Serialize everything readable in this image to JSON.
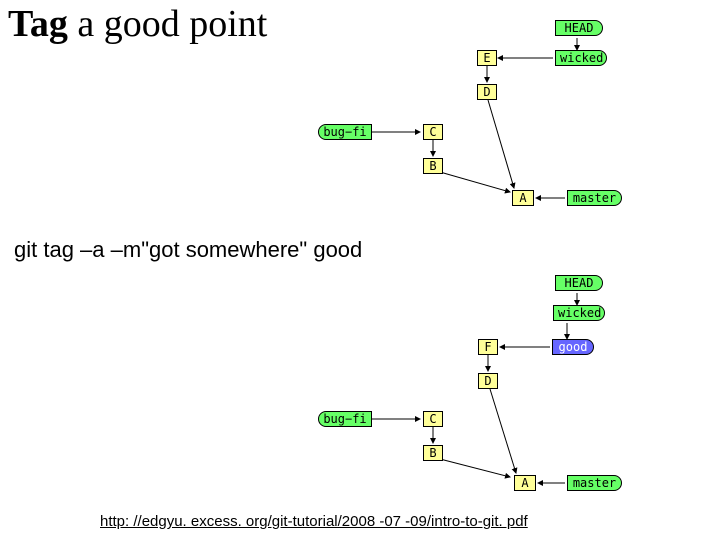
{
  "title_prefix": "Tag",
  "title_rest": " a good point",
  "command": "git tag –a –m\"got somewhere\" good",
  "footer": "http: //edgyu. excess. org/git-tutorial/2008 -07 -09/intro-to-git. pdf",
  "upper": {
    "commits": {
      "E": "E",
      "D": "D",
      "C": "C",
      "B": "B",
      "A": "A"
    },
    "refs": {
      "head": "HEAD",
      "wicked": "wicked",
      "bugfi": "bug−fi",
      "master": "master"
    }
  },
  "lower": {
    "commits": {
      "F": "F",
      "D": "D",
      "C": "C",
      "B": "B",
      "A": "A"
    },
    "refs": {
      "head": "HEAD",
      "wicked": "wicked",
      "bugfi": "bug−fi",
      "master": "master",
      "good": "good"
    }
  },
  "chart_data": [
    {
      "type": "dag",
      "title": "Repository state before tagging",
      "nodes": [
        {
          "id": "E",
          "kind": "commit"
        },
        {
          "id": "D",
          "kind": "commit"
        },
        {
          "id": "C",
          "kind": "commit"
        },
        {
          "id": "B",
          "kind": "commit"
        },
        {
          "id": "A",
          "kind": "commit"
        },
        {
          "id": "HEAD",
          "kind": "head",
          "points_to": "wicked"
        },
        {
          "id": "wicked",
          "kind": "branch",
          "points_to": "E"
        },
        {
          "id": "bug-fi",
          "kind": "branch",
          "points_to": "C"
        },
        {
          "id": "master",
          "kind": "branch",
          "points_to": "A"
        }
      ],
      "edges": [
        {
          "from": "E",
          "to": "D"
        },
        {
          "from": "D",
          "to": "A"
        },
        {
          "from": "C",
          "to": "B"
        },
        {
          "from": "B",
          "to": "A"
        }
      ]
    },
    {
      "type": "dag",
      "title": "Repository state after `git tag -a -m\"got somewhere\" good`",
      "nodes": [
        {
          "id": "F",
          "kind": "commit"
        },
        {
          "id": "D",
          "kind": "commit"
        },
        {
          "id": "C",
          "kind": "commit"
        },
        {
          "id": "B",
          "kind": "commit"
        },
        {
          "id": "A",
          "kind": "commit"
        },
        {
          "id": "HEAD",
          "kind": "head",
          "points_to": "wicked"
        },
        {
          "id": "wicked",
          "kind": "branch",
          "points_to": "F"
        },
        {
          "id": "bug-fi",
          "kind": "branch",
          "points_to": "C"
        },
        {
          "id": "master",
          "kind": "branch",
          "points_to": "A"
        },
        {
          "id": "good",
          "kind": "tag",
          "points_to": "F"
        }
      ],
      "edges": [
        {
          "from": "F",
          "to": "D"
        },
        {
          "from": "D",
          "to": "A"
        },
        {
          "from": "C",
          "to": "B"
        },
        {
          "from": "B",
          "to": "A"
        }
      ]
    }
  ]
}
